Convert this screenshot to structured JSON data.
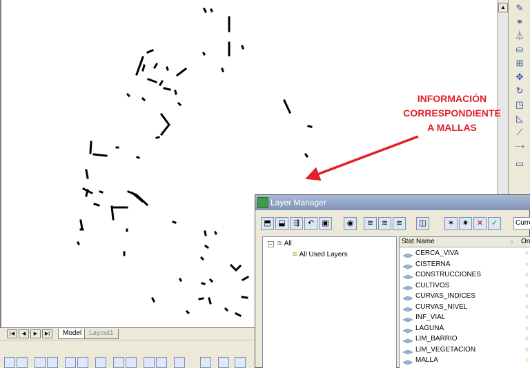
{
  "annotation": {
    "lines": [
      "INFORMACIÓN",
      "CORRESPONDIENTE",
      "A MALLAS"
    ],
    "color": "#e21f26"
  },
  "layout_tabs": {
    "model": "Model",
    "layout1": "Layout1"
  },
  "layer_manager": {
    "title": "Layer Manager",
    "current_label": "Curre",
    "tree": {
      "root": "All",
      "child": "All Used Layers"
    },
    "columns": {
      "stat": "Stat",
      "name": "Name",
      "on": "On"
    },
    "layers": [
      {
        "name": "CERCA_VIVA",
        "on": true
      },
      {
        "name": "CISTERNA",
        "on": true
      },
      {
        "name": "CONSTRUCCIONES",
        "on": true
      },
      {
        "name": "CULTIVOS",
        "on": true
      },
      {
        "name": "CURVAS_INDICES",
        "on": true
      },
      {
        "name": "CURVAS_NIVEL",
        "on": true
      },
      {
        "name": "INF_VIAL",
        "on": true
      },
      {
        "name": "LAGUNA",
        "on": true
      },
      {
        "name": "LIM_BARRIO",
        "on": true
      },
      {
        "name": "LIM_VEGETACION",
        "on": true
      },
      {
        "name": "MALLA",
        "on": true
      }
    ]
  },
  "icons": {
    "toolbar_right": [
      "pencil-icon",
      "copy-icon",
      "mirror-icon",
      "offset-icon",
      "array-icon",
      "move-icon",
      "rotate-icon",
      "scale-icon",
      "stretch-icon",
      "trim-icon",
      "extend-icon",
      "rectangle-icon"
    ]
  }
}
